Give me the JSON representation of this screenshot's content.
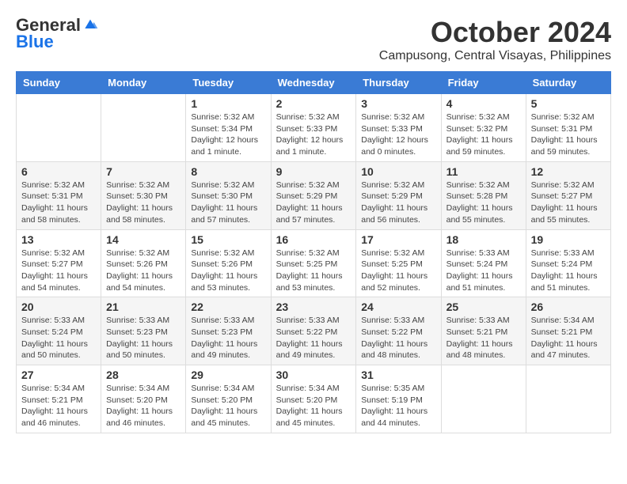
{
  "logo": {
    "line1": "General",
    "line2": "Blue"
  },
  "title": "October 2024",
  "location": "Campusong, Central Visayas, Philippines",
  "days_of_week": [
    "Sunday",
    "Monday",
    "Tuesday",
    "Wednesday",
    "Thursday",
    "Friday",
    "Saturday"
  ],
  "weeks": [
    [
      {
        "day": "",
        "info": ""
      },
      {
        "day": "",
        "info": ""
      },
      {
        "day": "1",
        "info": "Sunrise: 5:32 AM\nSunset: 5:34 PM\nDaylight: 12 hours and 1 minute."
      },
      {
        "day": "2",
        "info": "Sunrise: 5:32 AM\nSunset: 5:33 PM\nDaylight: 12 hours and 1 minute."
      },
      {
        "day": "3",
        "info": "Sunrise: 5:32 AM\nSunset: 5:33 PM\nDaylight: 12 hours and 0 minutes."
      },
      {
        "day": "4",
        "info": "Sunrise: 5:32 AM\nSunset: 5:32 PM\nDaylight: 11 hours and 59 minutes."
      },
      {
        "day": "5",
        "info": "Sunrise: 5:32 AM\nSunset: 5:31 PM\nDaylight: 11 hours and 59 minutes."
      }
    ],
    [
      {
        "day": "6",
        "info": "Sunrise: 5:32 AM\nSunset: 5:31 PM\nDaylight: 11 hours and 58 minutes."
      },
      {
        "day": "7",
        "info": "Sunrise: 5:32 AM\nSunset: 5:30 PM\nDaylight: 11 hours and 58 minutes."
      },
      {
        "day": "8",
        "info": "Sunrise: 5:32 AM\nSunset: 5:30 PM\nDaylight: 11 hours and 57 minutes."
      },
      {
        "day": "9",
        "info": "Sunrise: 5:32 AM\nSunset: 5:29 PM\nDaylight: 11 hours and 57 minutes."
      },
      {
        "day": "10",
        "info": "Sunrise: 5:32 AM\nSunset: 5:29 PM\nDaylight: 11 hours and 56 minutes."
      },
      {
        "day": "11",
        "info": "Sunrise: 5:32 AM\nSunset: 5:28 PM\nDaylight: 11 hours and 55 minutes."
      },
      {
        "day": "12",
        "info": "Sunrise: 5:32 AM\nSunset: 5:27 PM\nDaylight: 11 hours and 55 minutes."
      }
    ],
    [
      {
        "day": "13",
        "info": "Sunrise: 5:32 AM\nSunset: 5:27 PM\nDaylight: 11 hours and 54 minutes."
      },
      {
        "day": "14",
        "info": "Sunrise: 5:32 AM\nSunset: 5:26 PM\nDaylight: 11 hours and 54 minutes."
      },
      {
        "day": "15",
        "info": "Sunrise: 5:32 AM\nSunset: 5:26 PM\nDaylight: 11 hours and 53 minutes."
      },
      {
        "day": "16",
        "info": "Sunrise: 5:32 AM\nSunset: 5:25 PM\nDaylight: 11 hours and 53 minutes."
      },
      {
        "day": "17",
        "info": "Sunrise: 5:32 AM\nSunset: 5:25 PM\nDaylight: 11 hours and 52 minutes."
      },
      {
        "day": "18",
        "info": "Sunrise: 5:33 AM\nSunset: 5:24 PM\nDaylight: 11 hours and 51 minutes."
      },
      {
        "day": "19",
        "info": "Sunrise: 5:33 AM\nSunset: 5:24 PM\nDaylight: 11 hours and 51 minutes."
      }
    ],
    [
      {
        "day": "20",
        "info": "Sunrise: 5:33 AM\nSunset: 5:24 PM\nDaylight: 11 hours and 50 minutes."
      },
      {
        "day": "21",
        "info": "Sunrise: 5:33 AM\nSunset: 5:23 PM\nDaylight: 11 hours and 50 minutes."
      },
      {
        "day": "22",
        "info": "Sunrise: 5:33 AM\nSunset: 5:23 PM\nDaylight: 11 hours and 49 minutes."
      },
      {
        "day": "23",
        "info": "Sunrise: 5:33 AM\nSunset: 5:22 PM\nDaylight: 11 hours and 49 minutes."
      },
      {
        "day": "24",
        "info": "Sunrise: 5:33 AM\nSunset: 5:22 PM\nDaylight: 11 hours and 48 minutes."
      },
      {
        "day": "25",
        "info": "Sunrise: 5:33 AM\nSunset: 5:21 PM\nDaylight: 11 hours and 48 minutes."
      },
      {
        "day": "26",
        "info": "Sunrise: 5:34 AM\nSunset: 5:21 PM\nDaylight: 11 hours and 47 minutes."
      }
    ],
    [
      {
        "day": "27",
        "info": "Sunrise: 5:34 AM\nSunset: 5:21 PM\nDaylight: 11 hours and 46 minutes."
      },
      {
        "day": "28",
        "info": "Sunrise: 5:34 AM\nSunset: 5:20 PM\nDaylight: 11 hours and 46 minutes."
      },
      {
        "day": "29",
        "info": "Sunrise: 5:34 AM\nSunset: 5:20 PM\nDaylight: 11 hours and 45 minutes."
      },
      {
        "day": "30",
        "info": "Sunrise: 5:34 AM\nSunset: 5:20 PM\nDaylight: 11 hours and 45 minutes."
      },
      {
        "day": "31",
        "info": "Sunrise: 5:35 AM\nSunset: 5:19 PM\nDaylight: 11 hours and 44 minutes."
      },
      {
        "day": "",
        "info": ""
      },
      {
        "day": "",
        "info": ""
      }
    ]
  ]
}
